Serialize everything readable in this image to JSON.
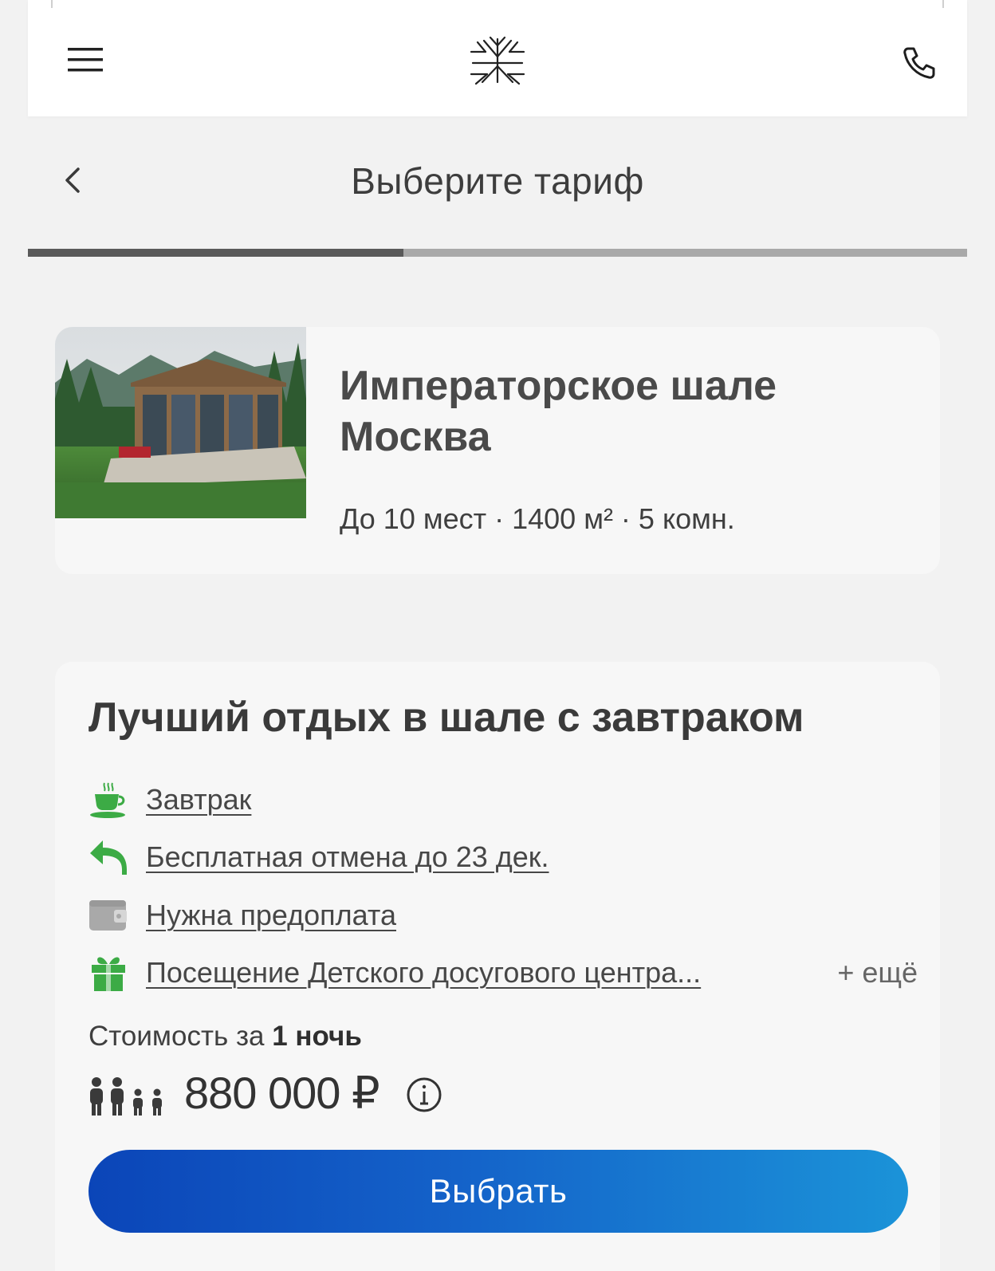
{
  "header": {
    "menu_icon": "hamburger-menu-icon",
    "logo_icon": "snowflake-logo-icon",
    "phone_icon": "phone-icon"
  },
  "title_bar": {
    "back_icon": "chevron-left-icon",
    "title": "Выберите тариф"
  },
  "progress": {
    "step_fraction": 0.4
  },
  "chalet": {
    "name": "Императорское шале Москва",
    "meta": "До 10 мест · 1400 м² · 5 комн."
  },
  "tariff": {
    "title": "Лучший отдых в шале с завтраком",
    "features": [
      {
        "icon": "cup-icon",
        "label": "Завтрак"
      },
      {
        "icon": "undo-arrow-icon",
        "label": "Бесплатная отмена до 23 дек."
      },
      {
        "icon": "wallet-icon",
        "label": "Нужна предоплата"
      },
      {
        "icon": "gift-icon",
        "label": "Посещение Детского досугового центра..."
      }
    ],
    "more_label": "+ ещё",
    "price_prefix": "Стоимость за ",
    "price_period": "1 ночь",
    "price": "880 000 ₽",
    "select_label": "Выбрать"
  },
  "colors": {
    "accent_green": "#3cab45",
    "button_start": "#0b45b8",
    "button_end": "#1b93d8"
  }
}
